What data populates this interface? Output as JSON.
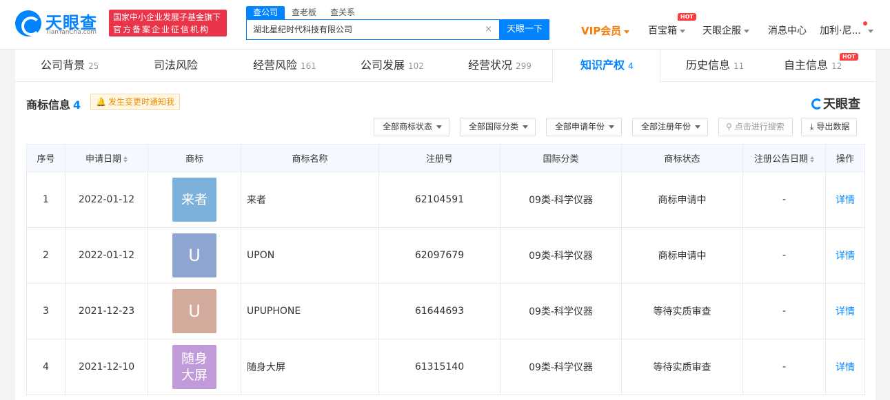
{
  "header": {
    "logo_text": "天眼查",
    "logo_sub": "TianYanCha.com",
    "banner_line1": "国家中小企业发展子基金旗下",
    "banner_line2": "官方备案企业征信机构",
    "search_tabs": [
      "查公司",
      "查老板",
      "查关系"
    ],
    "search_value": "湖北星纪时代科技有限公司",
    "search_clear": "×",
    "search_button": "天眼一下",
    "nav": {
      "vip": "VIP会员",
      "baibaoxiang": "百宝箱",
      "hot": "HOT",
      "qifu": "天眼企服",
      "messages": "消息中心",
      "user": "加利·尼..."
    }
  },
  "tabs": [
    {
      "label": "公司背景",
      "count": "25"
    },
    {
      "label": "司法风险",
      "count": ""
    },
    {
      "label": "经营风险",
      "count": "161"
    },
    {
      "label": "公司发展",
      "count": "102"
    },
    {
      "label": "经营状况",
      "count": "299"
    },
    {
      "label": "知识产权",
      "count": "4"
    },
    {
      "label": "历史信息",
      "count": "11"
    },
    {
      "label": "自主信息",
      "count": "12"
    }
  ],
  "tabs_hot": "HOT",
  "section": {
    "title": "商标信息",
    "count": "4",
    "notify": "发生变更时通知我",
    "watermark": "天眼查"
  },
  "filters": {
    "status": "全部商标状态",
    "intl_class": "全部国际分类",
    "apply_year": "全部申请年份",
    "reg_year": "全部注册年份",
    "search_placeholder": "点击进行搜索",
    "export": "导出数据"
  },
  "table": {
    "headers": [
      "序号",
      "申请日期",
      "商标",
      "商标名称",
      "注册号",
      "国际分类",
      "商标状态",
      "注册公告日期",
      "操作"
    ],
    "rows": [
      {
        "no": "1",
        "date": "2022-01-12",
        "mark": "来者",
        "name": "来者",
        "reg": "62104591",
        "class": "09类-科学仪器",
        "status": "商标申请中",
        "pub": "-",
        "action": "详情"
      },
      {
        "no": "2",
        "date": "2022-01-12",
        "mark": "U",
        "name": "UPON",
        "reg": "62097679",
        "class": "09类-科学仪器",
        "status": "商标申请中",
        "pub": "-",
        "action": "详情"
      },
      {
        "no": "3",
        "date": "2021-12-23",
        "mark": "U",
        "name": "UPUPHONE",
        "reg": "61644693",
        "class": "09类-科学仪器",
        "status": "等待实质审查",
        "pub": "-",
        "action": "详情"
      },
      {
        "no": "4",
        "date": "2021-12-10",
        "mark_line1": "随身",
        "mark_line2": "大屏",
        "name": "随身大屏",
        "reg": "61315140",
        "class": "09类-科学仪器",
        "status": "等待实质审查",
        "pub": "-",
        "action": "详情"
      }
    ]
  },
  "colors": {
    "accent": "#0084ff",
    "mark1": "#7cb1dc",
    "mark2": "#8ea5d0",
    "mark3": "#d2ab9c",
    "mark4": "#c09ad9"
  }
}
